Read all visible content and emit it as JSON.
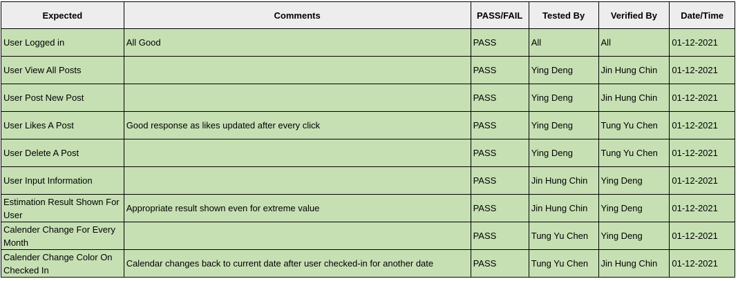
{
  "table": {
    "headers": [
      "Expected",
      "Comments",
      "PASS/FAIL",
      "Tested By",
      "Verified By",
      "Date/Time"
    ],
    "rows": [
      {
        "expected": "User Logged in",
        "comments": "All Good",
        "status": "PASS",
        "tested_by": "All",
        "verified_by": "All",
        "date": "01-12-2021"
      },
      {
        "expected": "User View All Posts",
        "comments": "",
        "status": "PASS",
        "tested_by": "Ying Deng",
        "verified_by": "Jin Hung Chin",
        "date": "01-12-2021"
      },
      {
        "expected": "User Post New Post",
        "comments": "",
        "status": "PASS",
        "tested_by": "Ying Deng",
        "verified_by": "Jin Hung Chin",
        "date": "01-12-2021"
      },
      {
        "expected": "User Likes A Post",
        "comments": "Good response as likes updated after every click",
        "status": "PASS",
        "tested_by": "Ying Deng",
        "verified_by": "Tung Yu Chen",
        "date": "01-12-2021"
      },
      {
        "expected": "User Delete A Post",
        "comments": "",
        "status": "PASS",
        "tested_by": "Ying Deng",
        "verified_by": "Tung Yu Chen",
        "date": "01-12-2021"
      },
      {
        "expected": "User Input Information",
        "comments": "",
        "status": "PASS",
        "tested_by": "Jin Hung Chin",
        "verified_by": "Ying Deng",
        "date": "01-12-2021"
      },
      {
        "expected": "Estimation Result Shown For User",
        "comments": "Appropriate result shown even for extreme value",
        "status": "PASS",
        "tested_by": "Jin Hung Chin",
        "verified_by": "Ying Deng",
        "date": "01-12-2021"
      },
      {
        "expected": "Calender Change For Every Month",
        "comments": "",
        "status": "PASS",
        "tested_by": "Tung Yu Chen",
        "verified_by": "Ying Deng",
        "date": "01-12-2021"
      },
      {
        "expected": "Calender Change Color On Checked In",
        "comments": "Calendar changes back to current date after user checked-in for another date",
        "status": "PASS",
        "tested_by": "Tung Yu Chen",
        "verified_by": "Jin Hung Chin",
        "date": "01-12-2021"
      }
    ]
  }
}
